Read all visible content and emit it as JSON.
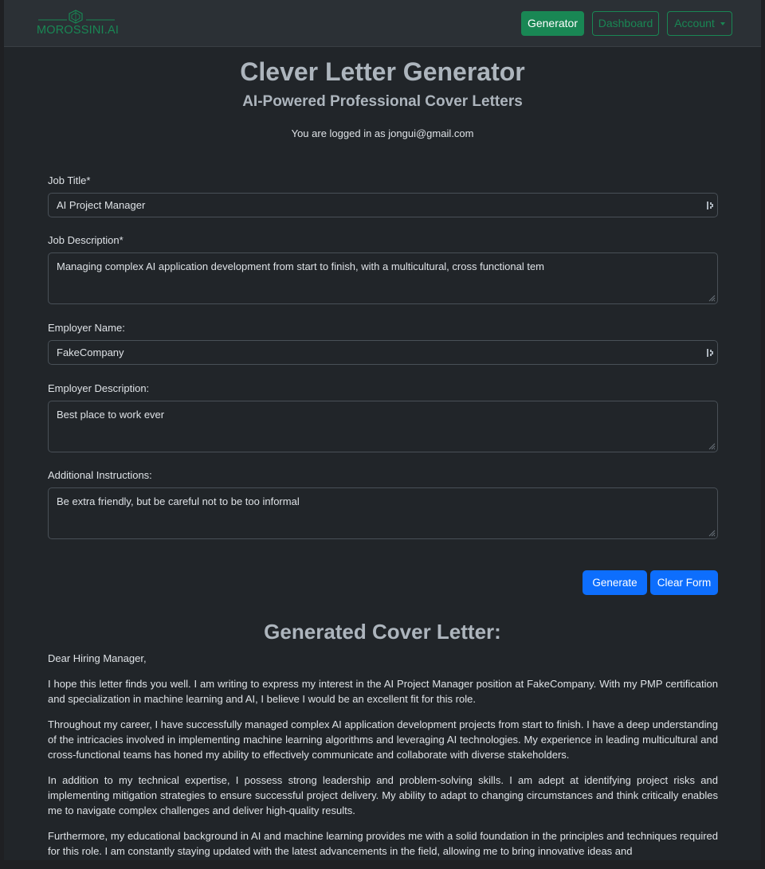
{
  "navbar": {
    "brand": "MOROSSINI.AI",
    "links": {
      "generator": "Generator",
      "dashboard": "Dashboard",
      "account": "Account"
    }
  },
  "header": {
    "title": "Clever Letter Generator",
    "subtitle": "AI-Powered Professional Cover Letters",
    "logged_in": "You are logged in as jongui@gmail.com"
  },
  "form": {
    "job_title": {
      "label": "Job Title*",
      "value": "AI Project Manager"
    },
    "job_description": {
      "label": "Job Description*",
      "value": "Managing complex AI application development from start to finish, with a multicultural, cross functional tem"
    },
    "employer_name": {
      "label": "Employer Name:",
      "value": "FakeCompany"
    },
    "employer_description": {
      "label": "Employer Description:",
      "value": "Best place to work ever"
    },
    "additional_instructions": {
      "label": "Additional Instructions:",
      "value": "Be extra friendly, but be careful not to be too informal"
    },
    "generate_label": "Generate",
    "clear_label": "Clear Form"
  },
  "output": {
    "heading": "Generated Cover Letter:",
    "paragraphs": [
      "Dear Hiring Manager,",
      "I hope this letter finds you well. I am writing to express my interest in the AI Project Manager position at FakeCompany. With my PMP certification and specialization in machine learning and AI, I believe I would be an excellent fit for this role.",
      "Throughout my career, I have successfully managed complex AI application development projects from start to finish. I have a deep understanding of the intricacies involved in implementing machine learning algorithms and leveraging AI technologies. My experience in leading multicultural and cross-functional teams has honed my ability to effectively communicate and collaborate with diverse stakeholders.",
      "In addition to my technical expertise, I possess strong leadership and problem-solving skills. I am adept at identifying project risks and implementing mitigation strategies to ensure successful project delivery. My ability to adapt to changing circumstances and think critically enables me to navigate complex challenges and deliver high-quality results.",
      "Furthermore, my educational background in AI and machine learning provides me with a solid foundation in the principles and techniques required for this role. I am constantly staying updated with the latest advancements in the field, allowing me to bring innovative ideas and"
    ]
  },
  "colors": {
    "brand_green": "#198754",
    "primary_blue": "#0d6efd",
    "background": "#212529"
  }
}
